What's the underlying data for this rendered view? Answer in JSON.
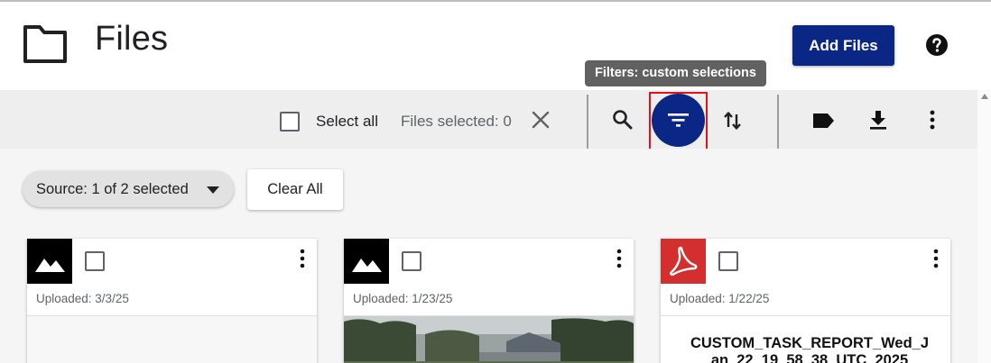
{
  "header": {
    "title": "Files",
    "add_files_label": "Add Files",
    "icons": {
      "folder": "folder-icon",
      "help": "help-icon"
    }
  },
  "tooltip": {
    "text": "Filters: custom selections"
  },
  "toolbar": {
    "select_all_label": "Select all",
    "files_selected_text": "Files selected: 0",
    "icons": [
      "close-icon",
      "search-icon",
      "filter-icon",
      "sort-icon",
      "tag-icon",
      "download-icon",
      "more-vert-icon"
    ]
  },
  "filters": {
    "source_chip_label": "Source: 1 of 2 selected",
    "clear_all_label": "Clear All"
  },
  "cards": [
    {
      "type": "image",
      "uploaded": "Uploaded: 3/3/25",
      "icon": "image-icon"
    },
    {
      "type": "image",
      "uploaded": "Uploaded: 1/23/25",
      "icon": "image-icon"
    },
    {
      "type": "pdf",
      "uploaded": "Uploaded: 1/22/25",
      "icon": "pdf-icon",
      "title": "CUSTOM_TASK_REPORT_Wed_Jan_22_19_58_38_UTC_2025"
    }
  ],
  "colors": {
    "primary": "#0a2785",
    "highlight": "#e0121a",
    "pdf": "#d32f2f",
    "tooltip": "#616161"
  }
}
